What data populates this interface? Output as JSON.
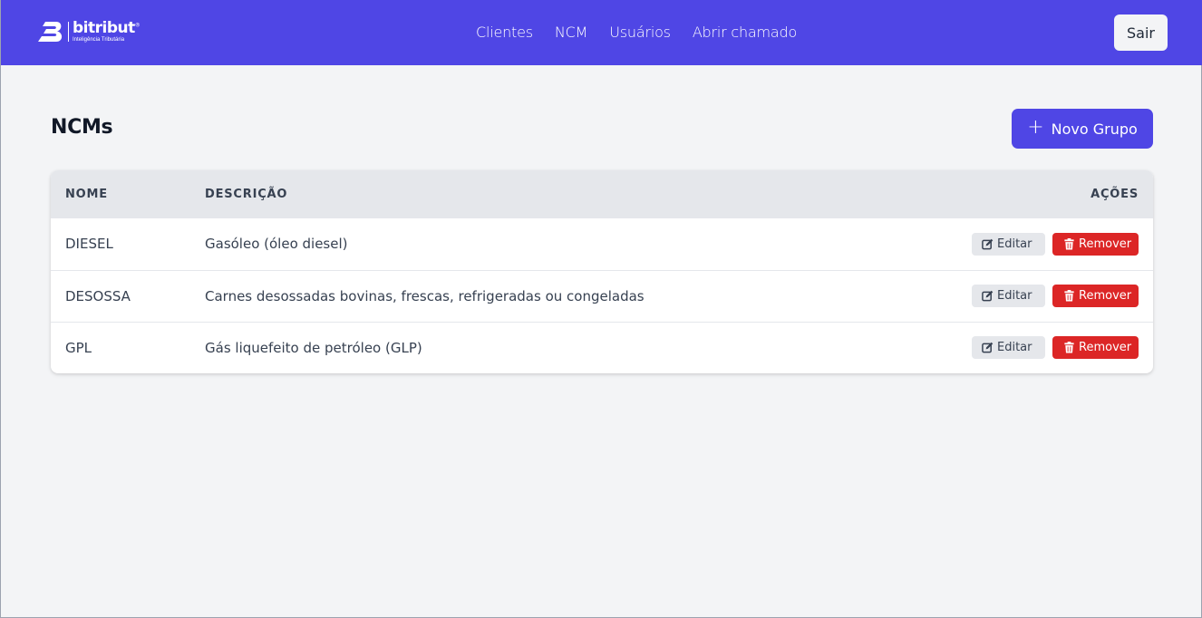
{
  "header": {
    "logo": {
      "brand": "bitribut",
      "trademark": "®",
      "tagline": "Inteligência Tributária"
    },
    "nav": [
      {
        "label": "Clientes"
      },
      {
        "label": "NCM"
      },
      {
        "label": "Usuários"
      },
      {
        "label": "Abrir chamado"
      }
    ],
    "logout_label": "Sair"
  },
  "page": {
    "title": "NCMs",
    "new_button_label": "Novo Grupo",
    "new_button_icon": "plus-icon"
  },
  "table": {
    "columns": {
      "name": "NOME",
      "description": "DESCRIÇÃO",
      "actions": "AÇÕES"
    },
    "rows": [
      {
        "name": "DIESEL",
        "description": "Gasóleo (óleo diesel)",
        "edit_label": "Editar",
        "remove_label": "Remover"
      },
      {
        "name": "DESOSSA",
        "description": "Carnes desossadas bovinas, frescas, refrigeradas ou congeladas",
        "edit_label": "Editar",
        "remove_label": "Remover"
      },
      {
        "name": "GPL",
        "description": "Gás liquefeito de petróleo (GLP)",
        "edit_label": "Editar",
        "remove_label": "Remover"
      }
    ]
  },
  "colors": {
    "primary": "#4f46e5",
    "danger": "#dc2626",
    "background": "#f3f4f6",
    "table_header": "#e5e7eb"
  }
}
